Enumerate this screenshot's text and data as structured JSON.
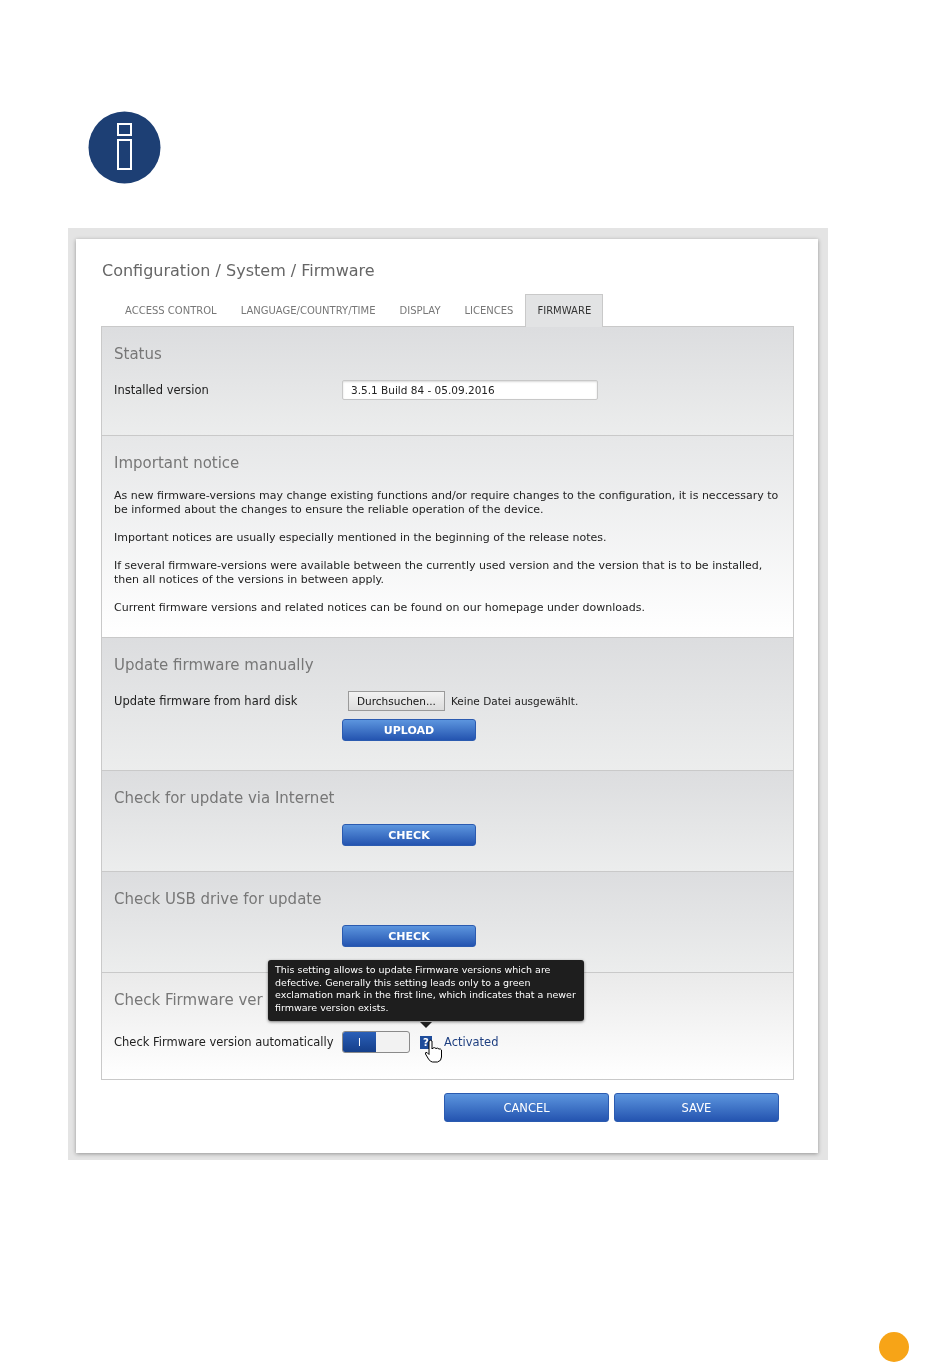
{
  "breadcrumb": "Configuration / System / Firmware",
  "tabs": [
    {
      "label": "ACCESS CONTROL",
      "selected": false
    },
    {
      "label": "LANGUAGE/COUNTRY/TIME",
      "selected": false
    },
    {
      "label": "DISPLAY",
      "selected": false
    },
    {
      "label": "LICENCES",
      "selected": false
    },
    {
      "label": "FIRMWARE",
      "selected": true
    }
  ],
  "sections": [
    {
      "kind": "field",
      "title": "Status",
      "label": "Installed version",
      "value": "3.5.1 Build 84 - 05.09.2016"
    },
    {
      "kind": "notice",
      "title": "Important notice",
      "paragraphs": [
        "As new firmware-versions may change existing functions and/or require changes to the configuration, it is neccessary to be informed about the changes to ensure the reliable operation of the device.",
        "Important notices are usually especially mentioned in the beginning of the release notes.",
        "If several firmware-versions were available between the currently used version and the version that is to be installed, then all notices of the versions in between apply.",
        "Current firmware versions and related notices can be found on our homepage under downloads."
      ]
    },
    {
      "kind": "upload",
      "title": "Update firmware manually",
      "label": "Update firmware from hard disk",
      "browse_button": "Durchsuchen...",
      "file_status": "Keine Datei ausgewählt.",
      "button": "UPLOAD"
    },
    {
      "kind": "button",
      "title": "Check for update via Internet",
      "button": "CHECK"
    },
    {
      "kind": "button",
      "title": "Check USB drive for update",
      "button": "CHECK"
    },
    {
      "kind": "toggle",
      "title": "Check Firmware ver",
      "label": "Check Firmware version automatically",
      "switch_label": "I",
      "on": true,
      "help": "?",
      "state_text": "Activated",
      "tooltip": "This setting allows to update Firmware versions which are defective. Generally this setting leads only to a green exclamation mark in the first line, which indicates that a newer firmware version exists."
    }
  ],
  "buttons": [
    "CANCEL",
    "SAVE"
  ]
}
